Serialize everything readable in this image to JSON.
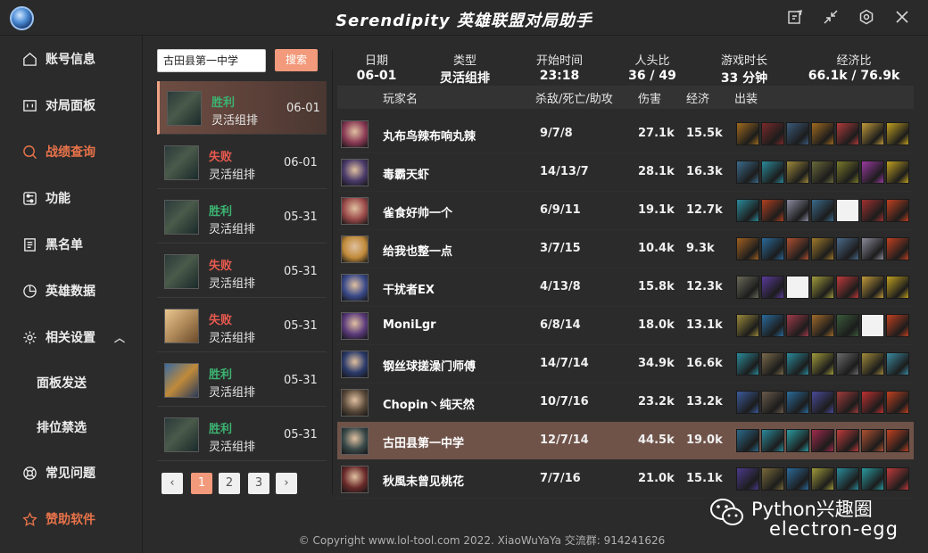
{
  "app": {
    "title": "Serendipity  英雄联盟对局助手"
  },
  "window_buttons": [
    "note-icon",
    "shrink-icon",
    "settings-icon",
    "close-icon"
  ],
  "sidebar": {
    "items": [
      {
        "label": "账号信息",
        "icon": "home-icon"
      },
      {
        "label": "对局面板",
        "icon": "panel-icon"
      },
      {
        "label": "战绩查询",
        "icon": "search-icon",
        "active": true
      },
      {
        "label": "功能",
        "icon": "sliders-icon"
      },
      {
        "label": "黑名单",
        "icon": "document-icon"
      },
      {
        "label": "英雄数据",
        "icon": "pie-chart-icon"
      },
      {
        "label": "相关设置",
        "icon": "gear-icon",
        "expanded": true
      },
      {
        "label": "面板发送",
        "sub": true
      },
      {
        "label": "排位禁选",
        "sub": true
      },
      {
        "label": "常见问题",
        "icon": "help-ring-icon"
      },
      {
        "label": "赞助软件",
        "icon": "star-icon",
        "highlight": true
      }
    ]
  },
  "search": {
    "value": "古田县第一中学",
    "button": "搜索"
  },
  "matches": [
    {
      "result": "胜利",
      "mode": "灵活组排",
      "date": "06-01",
      "win": true,
      "selected": true
    },
    {
      "result": "失败",
      "mode": "灵活组排",
      "date": "06-01",
      "win": false
    },
    {
      "result": "胜利",
      "mode": "灵活组排",
      "date": "05-31",
      "win": true
    },
    {
      "result": "失败",
      "mode": "灵活组排",
      "date": "05-31",
      "win": false
    },
    {
      "result": "失败",
      "mode": "灵活组排",
      "date": "05-31",
      "win": false
    },
    {
      "result": "胜利",
      "mode": "灵活组排",
      "date": "05-31",
      "win": true
    },
    {
      "result": "胜利",
      "mode": "灵活组排",
      "date": "05-31",
      "win": true
    }
  ],
  "pagination": {
    "prev": "‹",
    "pages": [
      "1",
      "2",
      "3"
    ],
    "current": "1",
    "next": "›"
  },
  "summary": {
    "date": {
      "label": "日期",
      "value": "06-01"
    },
    "type": {
      "label": "类型",
      "value": "灵活组排"
    },
    "start": {
      "label": "开始时间",
      "value": "23:18"
    },
    "kills": {
      "label": "人头比",
      "value": "36 / 49"
    },
    "duration": {
      "label": "游戏时长",
      "value": "33 分钟"
    },
    "economy": {
      "label": "经济比",
      "value": "66.1k / 76.9k"
    }
  },
  "table": {
    "headers": {
      "name": "玩家名",
      "kda": "杀敌/死亡/助攻",
      "damage": "伤害",
      "gold": "经济",
      "items": "出装"
    },
    "players": [
      {
        "name": "丸布鸟辣布响丸辣",
        "kda": "9/7/8",
        "damage": "27.1k",
        "gold": "15.5k",
        "avatar": "#8a3a55",
        "items": [
          "#a06a1e",
          "#7a2a2a",
          "#3a5a7a",
          "#a06a1e",
          "#b03a3a",
          "#c09a3a",
          "#c0a020"
        ]
      },
      {
        "name": "毒霸天虾",
        "kda": "14/13/7",
        "damage": "28.1k",
        "gold": "16.3k",
        "avatar": "#4a3a6a",
        "items": [
          "#3a6a8a",
          "#2a8a9a",
          "#a08a3a",
          "#6a6a3a",
          "#7a7a2a",
          "#9a3aa0",
          "#c0a020"
        ]
      },
      {
        "name": "雀食好帅一个",
        "kda": "6/9/11",
        "damage": "19.1k",
        "gold": "12.7k",
        "avatar": "#9a4a4a",
        "items": [
          "#2a8a9a",
          "#b04020",
          "#8a8aa0",
          "#3a6a8a",
          "empty",
          "#a03030",
          "#c04020"
        ]
      },
      {
        "name": "给我也整一点",
        "kda": "3/7/15",
        "damage": "10.4k",
        "gold": "9.3k",
        "avatar": "#c08a3a",
        "items": [
          "#a06020",
          "#2a6a9a",
          "#b05030",
          "#a07a2a",
          "#4a6a8a",
          "#8a8a9a",
          "#c04020"
        ]
      },
      {
        "name": "干扰者EX",
        "kda": "4/13/8",
        "damage": "15.8k",
        "gold": "12.3k",
        "avatar": "#3a4a8a",
        "items": [
          "#6a6a5a",
          "#5a3a9a",
          "empty",
          "#a09a3a",
          "#c03a3a",
          "#c09a3a",
          "#c0a020"
        ]
      },
      {
        "name": "MoniLgr",
        "kda": "6/8/14",
        "damage": "18.0k",
        "gold": "13.1k",
        "avatar": "#5a3a7a",
        "items": [
          "#9a8a3a",
          "#2a6a9a",
          "#a03a4a",
          "#a06a2a",
          "#3a5a3a",
          "empty",
          "#c04020"
        ]
      },
      {
        "name": "钢丝球搓澡门师傅",
        "kda": "14/7/14",
        "damage": "34.9k",
        "gold": "16.6k",
        "avatar": "#2a3a6a",
        "items": [
          "#2a8a9a",
          "#7a6a4a",
          "#2a8a9a",
          "#a09a3a",
          "#6a6a6a",
          "#a08a3a",
          "#3a8aa0"
        ]
      },
      {
        "name": "Chopin丶纯天然",
        "kda": "10/7/16",
        "damage": "23.2k",
        "gold": "13.2k",
        "avatar": "#5a4a3a",
        "items": [
          "#3a5a9a",
          "#6a5a4a",
          "#2a6a9a",
          "#4a4a9a",
          "#a03a3a",
          "#c03030",
          "#c04020"
        ]
      },
      {
        "name": "古田县第一中学",
        "kda": "12/7/14",
        "damage": "44.5k",
        "gold": "19.0k",
        "avatar": "#3a4a4a",
        "me": true,
        "items": [
          "#2a6a8a",
          "#2a8a9a",
          "#2a9aa0",
          "#a02a4a",
          "#c03a3a",
          "#b05030",
          "#c04020"
        ]
      },
      {
        "name": "秋風未曾见桃花",
        "kda": "7/7/16",
        "damage": "21.0k",
        "gold": "15.1k",
        "avatar": "#6a2a2a",
        "items": [
          "#4a3a8a",
          "#7a6a3a",
          "#2a6a9a",
          "#a09a3a",
          "#2a8a9a",
          "#2a9aa0",
          "#c03a3a"
        ]
      }
    ]
  },
  "footer": {
    "text": "© Copyright www.lol-tool.com 2022.   XiaoWuYaYa  交流群: 914241626"
  },
  "watermark": {
    "line1": "Python兴趣圈",
    "line2": "electron-egg"
  }
}
